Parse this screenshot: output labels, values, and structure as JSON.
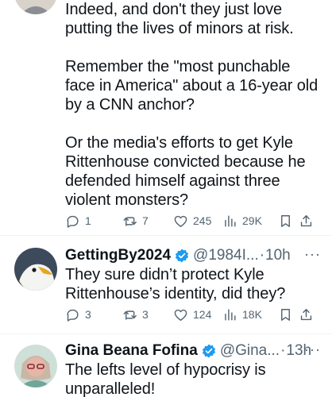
{
  "tweets": [
    {
      "text": "Indeed, and don't they just love putting the lives of minors at risk.\n\nRemember the \"most punchable face in America\" about a 16-year old by a CNN anchor?\n\nOr the media's efforts to get Kyle Rittenhouse convicted because he defended himself against three violent monsters?",
      "replies": "1",
      "retweets": "7",
      "likes": "245",
      "views": "29K"
    },
    {
      "display_name": "GettingBy2024",
      "handle": "@1984I...",
      "separator": "·",
      "time": "10h",
      "more": "···",
      "text": "They sure didn’t protect Kyle Rittenhouse’s identity, did they?",
      "replies": "3",
      "retweets": "3",
      "likes": "124",
      "views": "18K"
    },
    {
      "display_name": "Gina Beana Fofina",
      "handle": "@Gina...",
      "separator": "·",
      "time": "13h",
      "more": "···",
      "text": "The lefts level of hypocrisy is unparalleled!"
    }
  ],
  "colors": {
    "text": "#0f1419",
    "muted": "#536471",
    "verified": "#1d9bf0",
    "divider": "#eff3f4"
  },
  "icons": [
    "reply-icon",
    "retweet-icon",
    "like-icon",
    "views-icon",
    "bookmark-icon",
    "share-icon",
    "verified-badge-icon"
  ]
}
